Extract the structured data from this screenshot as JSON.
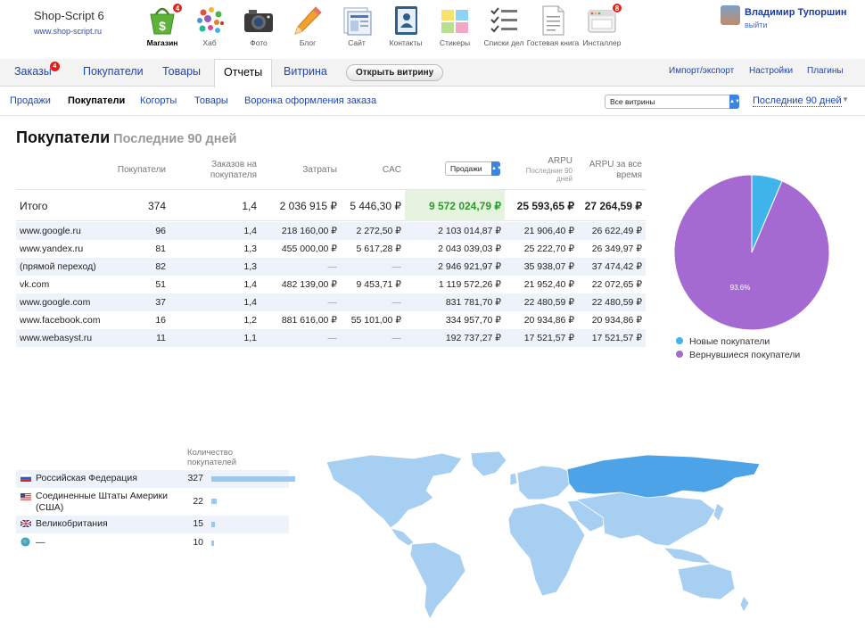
{
  "brand": {
    "name": "Shop-Script 6",
    "url": "www.shop-script.ru"
  },
  "apps": [
    {
      "label": "Магазин",
      "badge": "4",
      "active": true,
      "icon": "shop-basket-icon"
    },
    {
      "label": "Хаб",
      "badge": "",
      "icon": "hub-dots-icon"
    },
    {
      "label": "Фото",
      "badge": "",
      "icon": "camera-icon"
    },
    {
      "label": "Блог",
      "badge": "",
      "icon": "pencil-icon"
    },
    {
      "label": "Сайт",
      "badge": "",
      "icon": "site-windows-icon"
    },
    {
      "label": "Контакты",
      "badge": "",
      "icon": "contacts-book-icon"
    },
    {
      "label": "Стикеры",
      "badge": "",
      "icon": "stickers-icon"
    },
    {
      "label": "Списки дел",
      "badge": "",
      "icon": "checklist-icon"
    },
    {
      "label": "Гостевая книга",
      "badge": "",
      "icon": "guestbook-icon"
    },
    {
      "label": "Инсталлер",
      "badge": "8",
      "icon": "installer-window-icon"
    }
  ],
  "user": {
    "name": "Владимир Тупоршин",
    "logout": "выйти"
  },
  "tabs": {
    "orders": "Заказы",
    "orders_badge": "4",
    "customers": "Покупатели",
    "products": "Товары",
    "reports": "Отчеты",
    "storefront": "Витрина",
    "open_store": "Открыть витрину",
    "import_export": "Импорт/экспорт",
    "settings": "Настройки",
    "plugins": "Плагины"
  },
  "subnav": {
    "sales": "Продажи",
    "customers": "Покупатели",
    "cohorts": "Когорты",
    "products": "Товары",
    "funnel": "Воронка оформления заказа",
    "store_select": "Все витрины",
    "period": "Последние 90 дней"
  },
  "page": {
    "title": "Покупатели",
    "period": "Последние 90 дней"
  },
  "table": {
    "headers": {
      "customers": "Покупатели",
      "orders_per_customer": "Заказов на покупателя",
      "cost": "Затраты",
      "cac": "CAC",
      "metric": "Продажи",
      "arpu": "ARPU",
      "arpu_sub": "Последние 90 дней",
      "arpu_all": "ARPU за все время"
    },
    "total": {
      "label": "Итого",
      "customers": "374",
      "orders": "1,4",
      "cost": "2 036 915 ₽",
      "cac": "5 446,30 ₽",
      "sales": "9 572 024,79 ₽",
      "arpu": "25 593,65 ₽",
      "arpu_all": "27 264,59 ₽"
    },
    "rows": [
      {
        "source": "www.google.ru",
        "customers": "96",
        "orders": "1,4",
        "cost": "218 160,00 ₽",
        "cac": "2 272,50 ₽",
        "sales": "2 103 014,87 ₽",
        "arpu": "21 906,40 ₽",
        "arpu_all": "26 622,49 ₽"
      },
      {
        "source": "www.yandex.ru",
        "customers": "81",
        "orders": "1,3",
        "cost": "455 000,00 ₽",
        "cac": "5 617,28 ₽",
        "sales": "2 043 039,03 ₽",
        "arpu": "25 222,70 ₽",
        "arpu_all": "26 349,97 ₽"
      },
      {
        "source": "(прямой переход)",
        "customers": "82",
        "orders": "1,3",
        "cost": "—",
        "cac": "—",
        "sales": "2 946 921,97 ₽",
        "arpu": "35 938,07 ₽",
        "arpu_all": "37 474,42 ₽"
      },
      {
        "source": "vk.com",
        "customers": "51",
        "orders": "1,4",
        "cost": "482 139,00 ₽",
        "cac": "9 453,71 ₽",
        "sales": "1 119 572,26 ₽",
        "arpu": "21 952,40 ₽",
        "arpu_all": "22 072,65 ₽"
      },
      {
        "source": "www.google.com",
        "customers": "37",
        "orders": "1,4",
        "cost": "—",
        "cac": "—",
        "sales": "831 781,70 ₽",
        "arpu": "22 480,59 ₽",
        "arpu_all": "22 480,59 ₽"
      },
      {
        "source": "www.facebook.com",
        "customers": "16",
        "orders": "1,2",
        "cost": "881 616,00 ₽",
        "cac": "55 101,00 ₽",
        "sales": "334 957,70 ₽",
        "arpu": "20 934,86 ₽",
        "arpu_all": "20 934,86 ₽"
      },
      {
        "source": "www.webasyst.ru",
        "customers": "11",
        "orders": "1,1",
        "cost": "—",
        "cac": "—",
        "sales": "192 737,27 ₽",
        "arpu": "17 521,57 ₽",
        "arpu_all": "17 521,57 ₽"
      }
    ]
  },
  "pie": {
    "slice_label": "93.6%",
    "legend": [
      {
        "label": "Новые покупатели",
        "color": "#3fb5ec"
      },
      {
        "label": "Вернувшиеся покупатели",
        "color": "#a56ad2"
      }
    ]
  },
  "countries": {
    "header": "Количество покупателей",
    "rows": [
      {
        "name": "Российская Федерация",
        "count": "327",
        "flag": "ru-flag-icon"
      },
      {
        "name": "Соединенные Штаты Америки (США)",
        "count": "22",
        "flag": "us-flag-icon"
      },
      {
        "name": "Великобритания",
        "count": "15",
        "flag": "gb-flag-icon"
      },
      {
        "name": "—",
        "count": "10",
        "flag": "globe-icon"
      }
    ]
  },
  "chart_data": [
    {
      "type": "pie",
      "title": "",
      "series": [
        {
          "name": "Новые покупатели",
          "value": 6.4,
          "color": "#3fb5ec"
        },
        {
          "name": "Вернувшиеся покупатели",
          "value": 93.6,
          "color": "#a56ad2"
        }
      ],
      "labels": [
        "",
        "93.6%"
      ],
      "legend": "bottom"
    },
    {
      "type": "bar",
      "title": "",
      "categories": [
        "Российская Федерация",
        "Соединенные Штаты Америки (США)",
        "Великобритания",
        "—"
      ],
      "values": [
        327,
        22,
        15,
        10
      ]
    }
  ]
}
